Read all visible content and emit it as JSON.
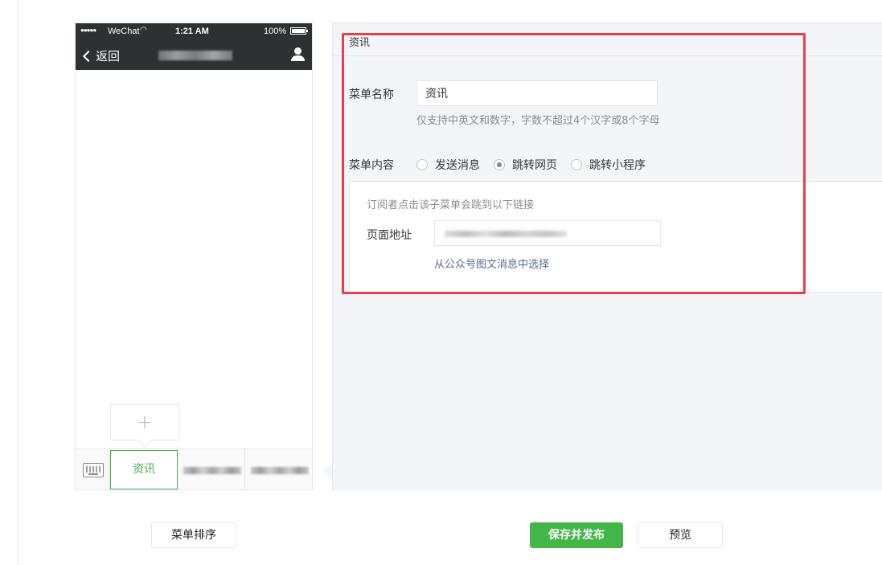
{
  "phone": {
    "status": {
      "carrier": "WeChat",
      "time": "1:21 AM",
      "battery": "100%"
    },
    "nav": {
      "back_label": "返回"
    },
    "add_sub_label": "+",
    "menu": {
      "active_item": "资讯"
    }
  },
  "editor": {
    "header_title": "资讯",
    "name": {
      "label": "菜单名称",
      "value": "资讯",
      "hint": "仅支持中英文和数字，字数不超过4个汉字或8个字母"
    },
    "content": {
      "label": "菜单内容",
      "options": [
        {
          "label": "发送消息",
          "checked": false
        },
        {
          "label": "跳转网页",
          "checked": true
        },
        {
          "label": "跳转小程序",
          "checked": false
        }
      ],
      "description": "订阅者点击该子菜单会跳到以下链接",
      "url_label": "页面地址",
      "pick_link": "从公众号图文消息中选择"
    }
  },
  "buttons": {
    "sort": "菜单排序",
    "save": "保存并发布",
    "preview": "预览"
  },
  "colors": {
    "accent": "#44b549",
    "highlight": "#e8404a",
    "link": "#576b95"
  }
}
